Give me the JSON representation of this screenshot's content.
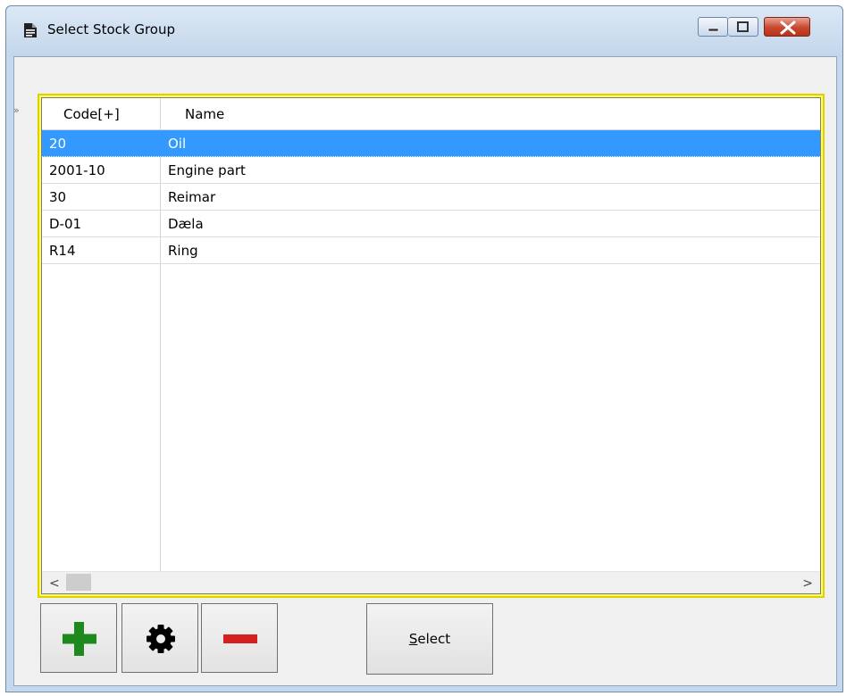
{
  "window": {
    "title": "Select Stock Group"
  },
  "grid": {
    "columns": [
      {
        "key": "code",
        "label": "Code[+]"
      },
      {
        "key": "name",
        "label": "Name"
      }
    ],
    "rows": [
      {
        "code": "20",
        "name": "Oil",
        "selected": true
      },
      {
        "code": "2001-10",
        "name": "Engine part",
        "selected": false
      },
      {
        "code": "30",
        "name": "Reimar",
        "selected": false
      },
      {
        "code": "D-01",
        "name": "Dæla",
        "selected": false
      },
      {
        "code": "R14",
        "name": "Ring",
        "selected": false
      }
    ],
    "caret_glyph": "»",
    "scroll_left_glyph": "<",
    "scroll_right_glyph": ">"
  },
  "toolbar": {
    "add_icon": "plus-icon",
    "edit_icon": "gear-icon",
    "remove_icon": "minus-icon",
    "add_color": "#1e8a1e",
    "remove_color": "#d42020",
    "select_accel": "S",
    "select_rest": "elect"
  },
  "colors": {
    "selection": "#3399ff",
    "grid_border": "#e0d000"
  }
}
